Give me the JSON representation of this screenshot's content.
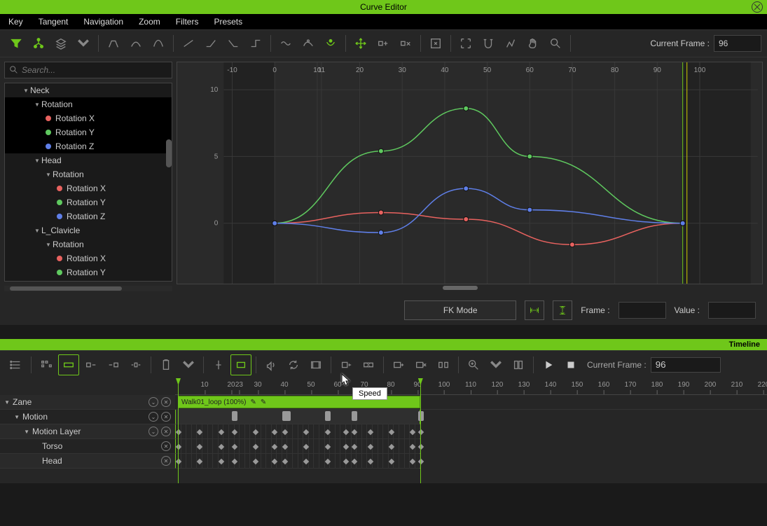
{
  "app": {
    "title": "Curve Editor"
  },
  "menu": [
    "Key",
    "Tangent",
    "Navigation",
    "Zoom",
    "Filters",
    "Presets"
  ],
  "toolbar": {
    "current_frame_label": "Current Frame :",
    "current_frame": "96"
  },
  "search": {
    "placeholder": "Search..."
  },
  "tree": [
    {
      "label": "Neck",
      "indent": 1,
      "caret": true,
      "sel": false
    },
    {
      "label": "Rotation",
      "indent": 2,
      "caret": true,
      "sel": true
    },
    {
      "label": "Rotation X",
      "indent": 3,
      "dot": "x",
      "sel": true
    },
    {
      "label": "Rotation Y",
      "indent": 3,
      "dot": "y",
      "sel": true
    },
    {
      "label": "Rotation Z",
      "indent": 3,
      "dot": "z",
      "sel": true
    },
    {
      "label": "Head",
      "indent": 2,
      "caret": true
    },
    {
      "label": "Rotation",
      "indent": 3,
      "caret": true
    },
    {
      "label": "Rotation X",
      "indent": 4,
      "dot": "x"
    },
    {
      "label": "Rotation Y",
      "indent": 4,
      "dot": "y"
    },
    {
      "label": "Rotation Z",
      "indent": 4,
      "dot": "z"
    },
    {
      "label": "L_Clavicle",
      "indent": 2,
      "caret": true
    },
    {
      "label": "Rotation",
      "indent": 3,
      "caret": true
    },
    {
      "label": "Rotation X",
      "indent": 4,
      "dot": "x"
    },
    {
      "label": "Rotation Y",
      "indent": 4,
      "dot": "y"
    }
  ],
  "chart_data": {
    "type": "line",
    "xlim": [
      -12,
      112
    ],
    "ylim": [
      -4,
      11
    ],
    "xticks": [
      -10,
      0,
      10,
      20,
      30,
      40,
      50,
      60,
      70,
      80,
      90,
      100,
      11
    ],
    "yticks": [
      0,
      5,
      10
    ],
    "shaded": [
      [
        -12,
        0
      ],
      [
        96,
        112
      ]
    ],
    "playhead": 96,
    "series": [
      {
        "name": "Rotation X",
        "color": "#e8625f",
        "keys": [
          [
            0,
            0
          ],
          [
            25,
            0.8
          ],
          [
            45,
            0.3
          ],
          [
            70,
            -1.6
          ],
          [
            96,
            0
          ]
        ]
      },
      {
        "name": "Rotation Y",
        "color": "#5fc95f",
        "keys": [
          [
            0,
            0
          ],
          [
            25,
            5.4
          ],
          [
            45,
            8.6
          ],
          [
            60,
            5.0
          ],
          [
            96,
            0
          ]
        ]
      },
      {
        "name": "Rotation Z",
        "color": "#5f7fe8",
        "keys": [
          [
            0,
            0
          ],
          [
            25,
            -0.7
          ],
          [
            45,
            2.6
          ],
          [
            60,
            1.0
          ],
          [
            96,
            0
          ]
        ]
      }
    ]
  },
  "controls": {
    "fk_mode": "FK Mode",
    "frame_label": "Frame :",
    "frame_value": "",
    "value_label": "Value :",
    "value_value": ""
  },
  "timeline": {
    "header": "Timeline",
    "current_frame_label": "Current Frame :",
    "current_frame": "96",
    "ticks": [
      10,
      20,
      30,
      40,
      50,
      60,
      70,
      80,
      90,
      100,
      110,
      120,
      130,
      140,
      150,
      160,
      170,
      180,
      190,
      200,
      210,
      220,
      23
    ],
    "playhead": 91,
    "tooltip": "Speed",
    "tracks_left": [
      {
        "label": "Zane",
        "indent": 0,
        "icons": [
          "eye",
          "x"
        ]
      },
      {
        "label": "Motion",
        "indent": 1,
        "icons": [
          "eye",
          "x"
        ]
      },
      {
        "label": "Motion Layer",
        "indent": 2,
        "icons": [
          "eye",
          "x"
        ]
      },
      {
        "label": "Torso",
        "indent": 3,
        "icons": [
          "x"
        ]
      },
      {
        "label": "Head",
        "indent": 3,
        "icons": [
          "x"
        ]
      }
    ],
    "clip": {
      "label": "Walk01_loop (100%)",
      "start": 0,
      "end": 91
    },
    "key_positions": [
      21,
      40,
      41,
      56,
      66,
      91
    ],
    "diamond_positions": [
      0,
      8,
      16,
      21,
      29,
      36,
      40,
      48,
      56,
      63,
      66,
      72,
      80,
      88,
      91
    ]
  }
}
